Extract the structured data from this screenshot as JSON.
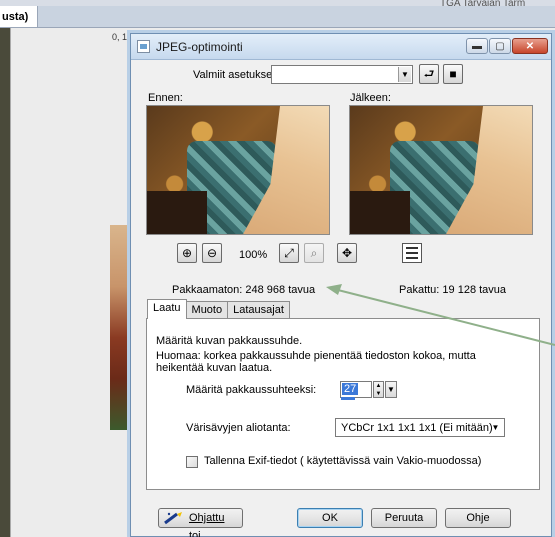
{
  "background_app": {
    "tab_label": "usta)",
    "top_right_text": "TGA Tarvajan Tarm",
    "ruler_label": "0, 1"
  },
  "dialog": {
    "title": "JPEG-optimointi",
    "presets_label": "Valmiit asetukset:",
    "presets_value": "",
    "before_label": "Ennen:",
    "after_label": "Jälkeen:",
    "zoom_percent": "100%",
    "uncompressed": "Pakkaamaton:  248 968 tavua",
    "compressed": "Pakattu: 19 128 tavua",
    "tabs": [
      {
        "label": "Laatu",
        "active": true
      },
      {
        "label": "Muoto",
        "active": false
      },
      {
        "label": "Latausajat",
        "active": false
      }
    ],
    "quality": {
      "description": "Määritä kuvan pakkaussuhde.",
      "note": "Huomaa: korkea pakkaussuhde pienentää tiedoston kokoa, mutta heikentää kuvan laatua.",
      "ratio_label": "Määritä pakkaussuhteeksi:",
      "ratio_value": "27",
      "subsampling_label": "Värisävyjen aliotanta:",
      "subsampling_value": "YCbCr  1x1  1x1  1x1  (Ei mitään)",
      "exif_label": "Tallenna Exif-tiedot ( käytettävissä vain Vakio-muodossa)",
      "exif_checked": false
    },
    "buttons": {
      "wizard": "Ohjattu toi...",
      "ok": "OK",
      "cancel": "Peruuta",
      "help": "Ohje"
    }
  }
}
